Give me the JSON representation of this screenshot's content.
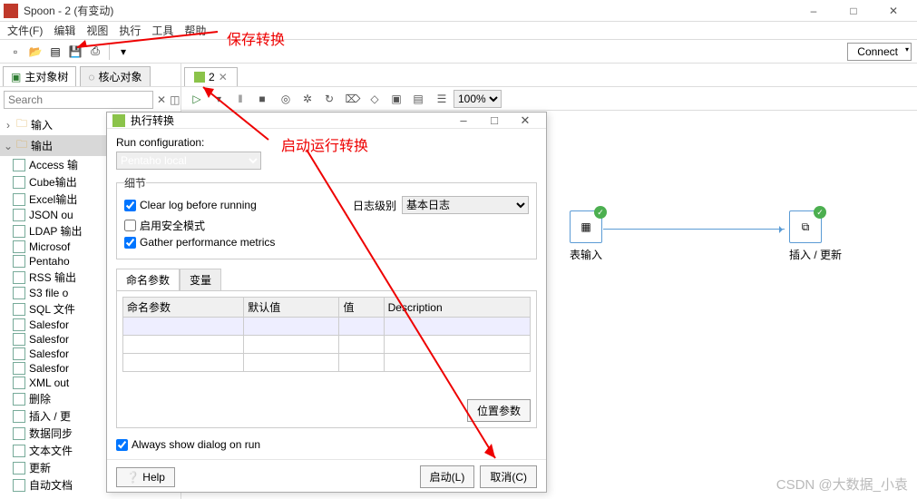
{
  "window": {
    "title": "Spoon - 2 (有变动)",
    "connect": "Connect"
  },
  "menu": {
    "file": "文件(F)",
    "edit": "编辑",
    "view": "视图",
    "action": "执行",
    "tools": "工具",
    "help": "帮助"
  },
  "side": {
    "tab_main": "主对象树",
    "tab_core": "核心对象",
    "search_placeholder": "Search",
    "input_folder": "输入",
    "output_folder": "输出",
    "items": [
      "Access 输",
      "Cube输出",
      "Excel输出",
      "JSON ou",
      "LDAP 输出",
      "Microsof",
      "Pentaho",
      "RSS 输出",
      "S3 file o",
      "SQL 文件",
      "Salesfor",
      "Salesfor",
      "Salesfor",
      "Salesfor",
      "XML out",
      "删除",
      "插入 / 更",
      "数据同步",
      "文本文件",
      "更新",
      "自动文档"
    ]
  },
  "canvas_tab": {
    "label": "2"
  },
  "canvas_tools": {
    "zoom": "100%"
  },
  "nodes": {
    "n1": "表输入",
    "n2": "插入 / 更新"
  },
  "annotations": {
    "save": "保存转换",
    "run": "启动运行转换"
  },
  "dialog": {
    "title": "执行转换",
    "run_config_label": "Run configuration:",
    "run_config_value": "Pentaho local",
    "details_legend": "细节",
    "clear_log": "Clear log before running",
    "safe_mode": "启用安全模式",
    "gather_metrics": "Gather performance metrics",
    "log_level_label": "日志级别",
    "log_level_value": "基本日志",
    "params_tab": "命名参数",
    "vars_tab": "变量",
    "cols": {
      "name": "命名参数",
      "default": "默认值",
      "value": "值",
      "desc": "Description"
    },
    "position_params": "位置参数",
    "always_show": "Always show dialog on run",
    "help": "Help",
    "run_btn": "启动(L)",
    "cancel_btn": "取消(C)"
  },
  "watermark": "CSDN @大数据_小袁"
}
